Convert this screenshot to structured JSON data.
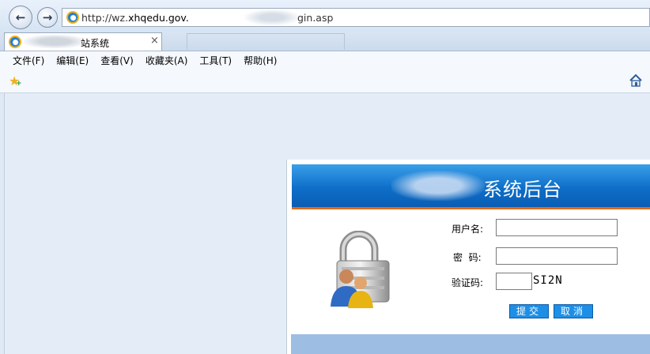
{
  "browser": {
    "address": {
      "url_prefix": "http://wz.",
      "url_domain": "xhqedu.gov.",
      "url_suffix": "gin.asp"
    },
    "tabs": [
      {
        "title": "站系统",
        "close": "×"
      }
    ],
    "menu": [
      {
        "label": "文件(F)"
      },
      {
        "label": "编辑(E)"
      },
      {
        "label": "查看(V)"
      },
      {
        "label": "收藏夹(A)"
      },
      {
        "label": "工具(T)"
      },
      {
        "label": "帮助(H)"
      }
    ],
    "icons": [
      "back-arrow-icon",
      "forward-arrow-icon",
      "ie-icon",
      "add-favorites-star-icon",
      "home-icon"
    ]
  },
  "page": {
    "header_title": "系统后台",
    "form": {
      "username_label": "用户名:",
      "password_label": "密  码:",
      "captcha_label": "验证码:",
      "captcha_text": "SI2N",
      "username_value": "",
      "password_value": "",
      "captcha_value": ""
    },
    "buttons": {
      "submit": "提交",
      "cancel": "取消"
    },
    "colors": {
      "header_blue": "#0e6fc9",
      "stripe_orange": "#e26a1a",
      "button_blue": "#1e8fe6",
      "footer_blue": "#9dbde3"
    }
  }
}
